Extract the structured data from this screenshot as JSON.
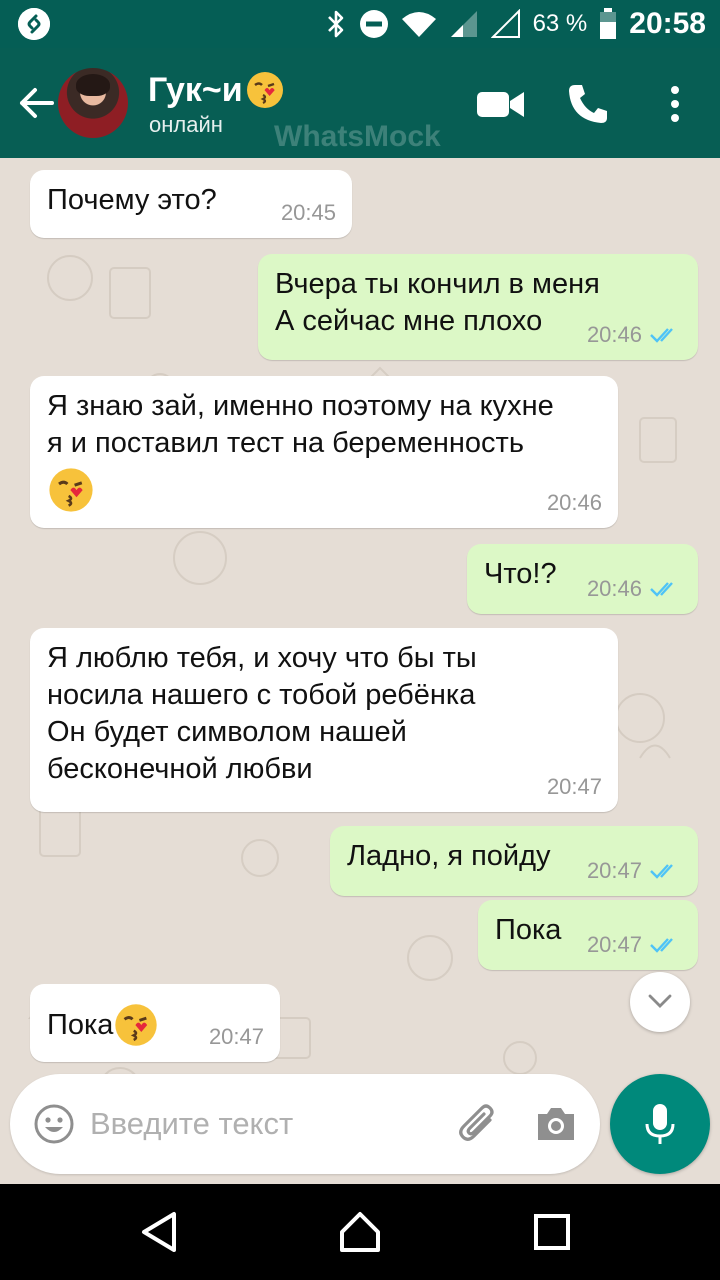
{
  "status_bar": {
    "battery_percent": "63 %",
    "time": "20:58",
    "icons": [
      "shazam-icon",
      "bluetooth-icon",
      "do-not-disturb-icon",
      "wifi-icon",
      "signal-icon",
      "battery-icon"
    ]
  },
  "header": {
    "contact_name": "Гук~и",
    "contact_status": "онлайн",
    "watermark": "WhatsMock",
    "icons": [
      "back-arrow-icon",
      "avatar",
      "video-call-icon",
      "phone-icon",
      "more-vert-icon"
    ]
  },
  "messages": [
    {
      "dir": "in",
      "text": "Почему это?",
      "time": "20:45"
    },
    {
      "dir": "out",
      "text": "Вчера ты кончил в меня\nА сейчас мне плохо",
      "time": "20:46",
      "status": "read"
    },
    {
      "dir": "in",
      "text": "Я знаю зай, именно поэтому на кухне\nя и поставил тест на беременность",
      "time": "20:46"
    },
    {
      "dir": "out",
      "text": "Что!?",
      "time": "20:46",
      "status": "read"
    },
    {
      "dir": "in",
      "text": "Я люблю тебя, и хочу что бы ты\nносила нашего с тобой ребёнка\nОн будет символом нашей\nбесконечной любви",
      "time": "20:47"
    },
    {
      "dir": "out",
      "text": "Ладно, я пойду",
      "time": "20:47",
      "status": "read"
    },
    {
      "dir": "out",
      "text": "Пока",
      "time": "20:47",
      "status": "read"
    },
    {
      "dir": "in",
      "text": "Пока",
      "time": "20:47"
    }
  ],
  "composer": {
    "placeholder": "Введите текст"
  },
  "colors": {
    "header": "#075e54",
    "status_bar": "#055e55",
    "chat_background": "#e5ddd5",
    "incoming_bubble": "#ffffff",
    "outgoing_bubble": "#dcf8c6",
    "read_ticks": "#4fc3f7",
    "mic_button": "#00897b"
  }
}
